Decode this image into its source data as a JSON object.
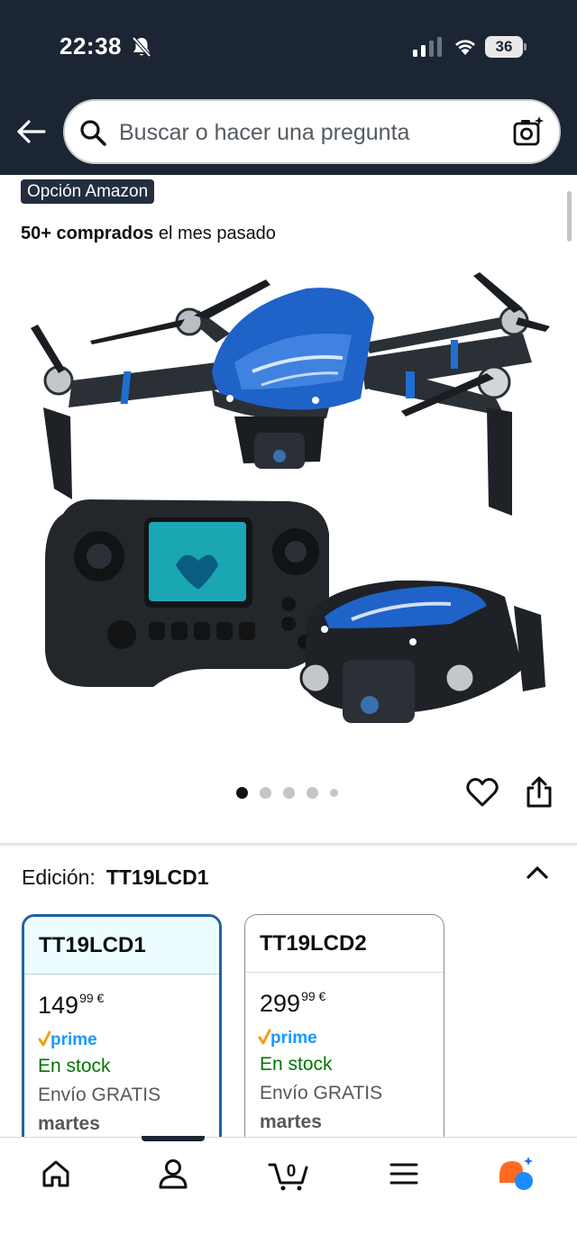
{
  "status_bar": {
    "time": "22:38",
    "battery_level": "36",
    "icons": [
      "bell-muted-icon",
      "signal-icon",
      "wifi-icon",
      "battery-icon"
    ]
  },
  "header": {
    "back_icon": "arrow-left-icon",
    "search_placeholder": "Buscar o hacer una pregunta",
    "search_icon": "search-icon",
    "camera_icon": "camera-sparkle-icon"
  },
  "product": {
    "badge": "Opción Amazon",
    "purchases_bold": "50+ comprados",
    "purchases_rest": " el mes pasado",
    "image": "drone-with-remote-controller",
    "carousel_total": 5,
    "carousel_active": 1
  },
  "actions": {
    "favorite_icon": "heart-icon",
    "share_icon": "share-icon"
  },
  "edition": {
    "label": "Edición:",
    "selected": "TT19LCD1",
    "options": [
      {
        "name": "TT19LCD1",
        "price_whole": "149",
        "price_fraction": "99",
        "currency": "€",
        "prime": "prime",
        "stock": "En stock",
        "shipping": "Envío GRATIS",
        "delivery_day": "martes"
      },
      {
        "name": "TT19LCD2",
        "price_whole": "299",
        "price_fraction": "99",
        "currency": "€",
        "prime": "prime",
        "stock": "En stock",
        "shipping": "Envío GRATIS",
        "delivery_day": "martes"
      }
    ]
  },
  "bottom_nav": {
    "items": [
      "home-icon",
      "account-icon",
      "cart-icon",
      "menu-icon",
      "rufus-icon"
    ],
    "cart_count": "0",
    "active_index": 1
  },
  "colors": {
    "header_bg": "#1b2533",
    "prime_blue": "#1a98ff",
    "stock_green": "#007600",
    "selected_border": "#2162a1"
  }
}
